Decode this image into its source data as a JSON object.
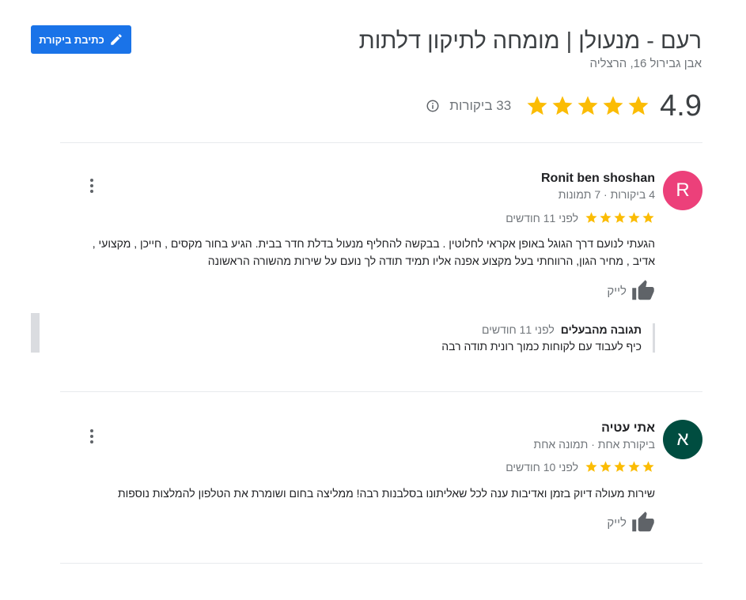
{
  "header": {
    "write_review_label": "כתיבת ביקורת",
    "business_name": "רעם - מנעולן | מומחה לתיקון דלתות",
    "address": "אבן גבירול 16, הרצליה",
    "rating": "4.9",
    "review_count": "33 ביקורות",
    "star_color": "#fbbc04",
    "accent": "#1a73e8"
  },
  "reviews": [
    {
      "avatar_letter": "R",
      "avatar_color": "#ec407a",
      "name": "Ronit ben shoshan",
      "meta": "4 ביקורות · 7 תמונות",
      "stars": 5,
      "time": "לפני 11 חודשים",
      "text": "הגעתי לנועם דרך הגוגל באופן אקראי לחלוטין . בבקשה להחליף מנעול בדלת חדר בבית. הגיע בחור מקסים , חייכן , מקצועי , אדיב , מחיר הגון, הרווחתי בעל מקצוע אפנה אליו תמיד תודה לך נועם על שירות מהשורה הראשונה",
      "like_label": "לייק",
      "owner_reply": {
        "title": "תגובה מהבעלים",
        "time": "לפני 11 חודשים",
        "text": "כיף לעבוד עם לקוחות כמוך רונית תודה רבה"
      }
    },
    {
      "avatar_letter": "א",
      "avatar_color": "#004d40",
      "name": "אתי עטיה",
      "meta": "ביקורת אחת · תמונה אחת",
      "stars": 5,
      "time": "לפני 10 חודשים",
      "text": "שירות מעולה דיוק בזמן ואדיבות ענה לכל שאליתונו בסלבנות רבה! ממליצה בחום ושומרת את הטלפון להמלצות נוספות",
      "like_label": "לייק"
    }
  ]
}
